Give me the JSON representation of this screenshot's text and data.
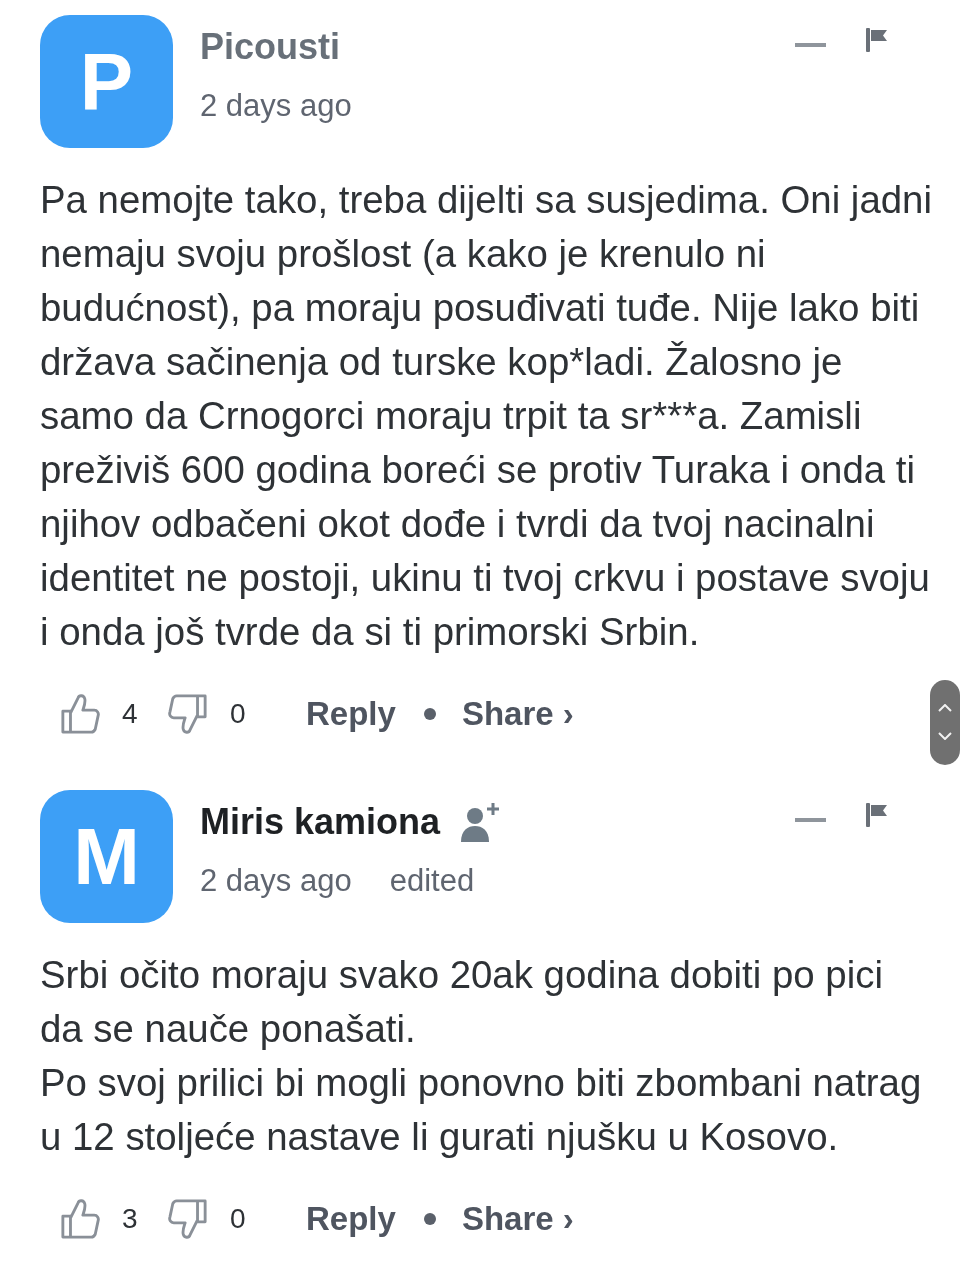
{
  "comments": [
    {
      "avatar_letter": "P",
      "author": "Picousti",
      "guest": true,
      "time": "2 days ago",
      "paragraphs": [
        "Pa nemojte tako, treba dijelti sa susjedima. Oni jadni nemaju svoju prošlost (a kako je krenulo ni budućnost), pa moraju posuđivati tuđe. Nije lako biti država sačinenja od turske kop*ladi. Žalosno je samo da Crnogorci moraju trpit ta sr***a. Zamisli preživiš 600 godina boreći se protiv Turaka i onda ti njihov odbačeni okot dođe i tvrdi da tvoj nacinalni identitet ne postoji, ukinu ti tvoj crkvu i postave svoju i onda još tvrde da si ti primorski Srbin."
      ],
      "upvotes": "4",
      "downvotes": "0",
      "reply": "Reply",
      "share": "Share ›"
    },
    {
      "avatar_letter": "M",
      "author": "Miris kamiona",
      "guest": false,
      "time": "2 days ago",
      "edited": "edited",
      "paragraphs": [
        "Srbi očito moraju svako 20ak godina dobiti po pici da se nauče ponašati.",
        "Po svoj prilici bi mogli ponovno biti zbombani natrag u 12 stoljeće nastave li gurati njušku u Kosovo."
      ],
      "upvotes": "3",
      "downvotes": "0",
      "reply": "Reply",
      "share": "Share ›"
    }
  ]
}
